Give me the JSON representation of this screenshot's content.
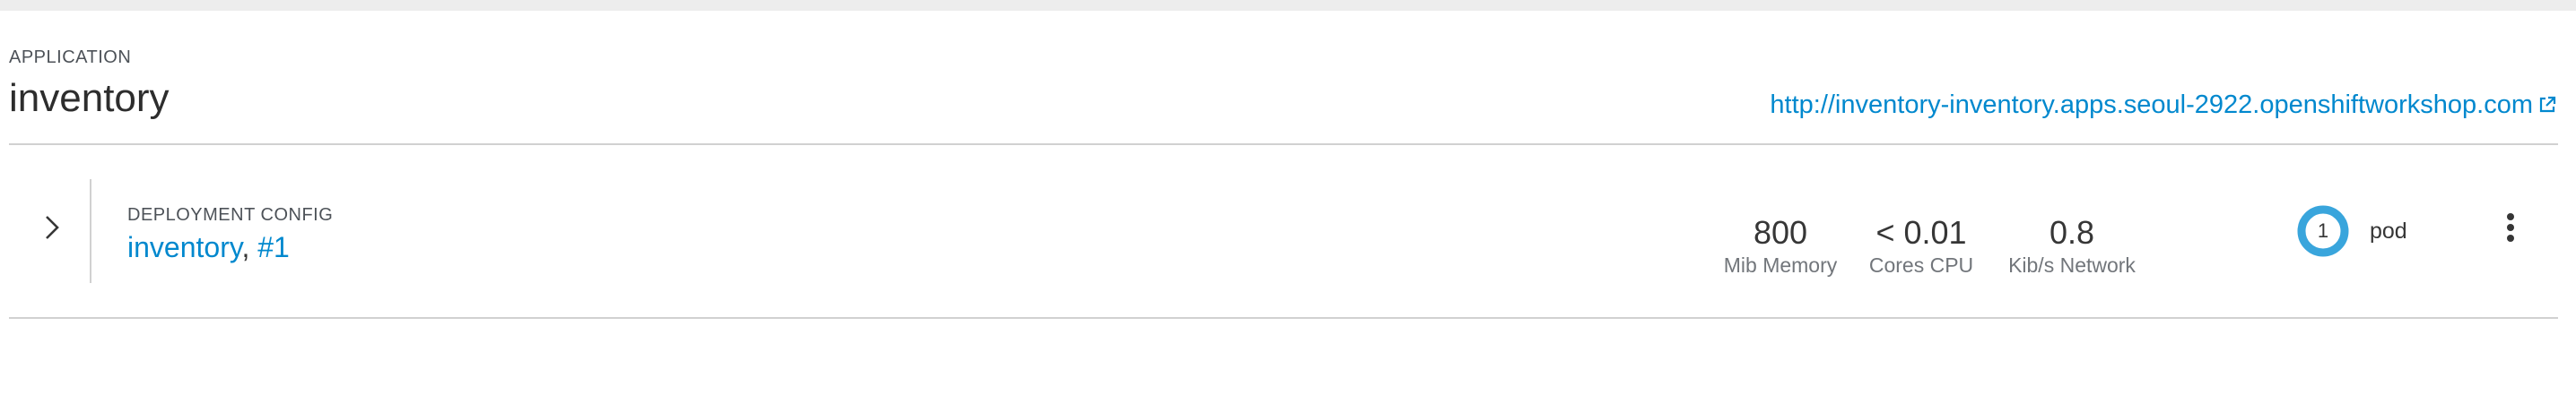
{
  "application": {
    "kind_label": "APPLICATION",
    "name": "inventory",
    "route_url": "http://inventory-inventory.apps.seoul-2922.openshiftworkshop.com"
  },
  "deployment": {
    "kind_label": "DEPLOYMENT CONFIG",
    "name": "inventory",
    "separator": ",",
    "revision": "#1",
    "metrics": [
      {
        "value": "800",
        "label": "Mib Memory"
      },
      {
        "value": "< 0.01",
        "label": "Cores CPU"
      },
      {
        "value": "0.8",
        "label": "Kib/s Network"
      }
    ],
    "pods": {
      "count": "1",
      "label": "pod"
    }
  },
  "colors": {
    "link": "#0088ce",
    "pod_running": "#39a5dc",
    "divider": "#d1d1d1",
    "top_strip": "#ededed"
  },
  "icons": {
    "external_link": "external-link-icon",
    "expand": "chevron-right-icon",
    "actions": "kebab-menu-icon"
  }
}
